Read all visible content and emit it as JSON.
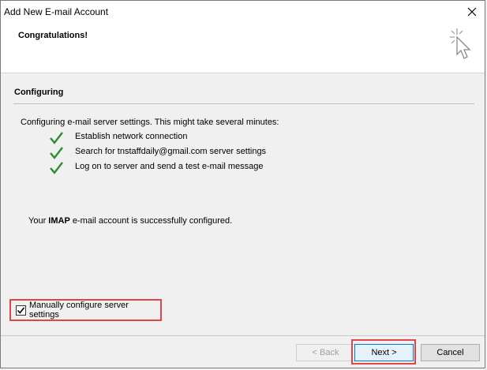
{
  "window": {
    "title": "Add New E-mail Account"
  },
  "header": {
    "title": "Congratulations!",
    "icon": "sparkle-cursor-icon"
  },
  "section": {
    "title": "Configuring"
  },
  "intro": "Configuring e-mail server settings. This might take several minutes:",
  "steps": [
    {
      "label": "Establish network connection",
      "status": "done"
    },
    {
      "label": "Search for tnstaffdaily@gmail.com server settings",
      "status": "done"
    },
    {
      "label": "Log on to server and send a test e-mail message",
      "status": "done"
    }
  ],
  "result": {
    "prefix": "Your ",
    "protocol": "IMAP",
    "suffix": " e-mail account is successfully configured."
  },
  "manual_config": {
    "label": "Manually configure server settings",
    "checked": true
  },
  "buttons": {
    "back": "< Back",
    "next": "Next >",
    "cancel": "Cancel"
  },
  "colors": {
    "check": "#2e8b2e",
    "highlight": "#e0454a"
  }
}
